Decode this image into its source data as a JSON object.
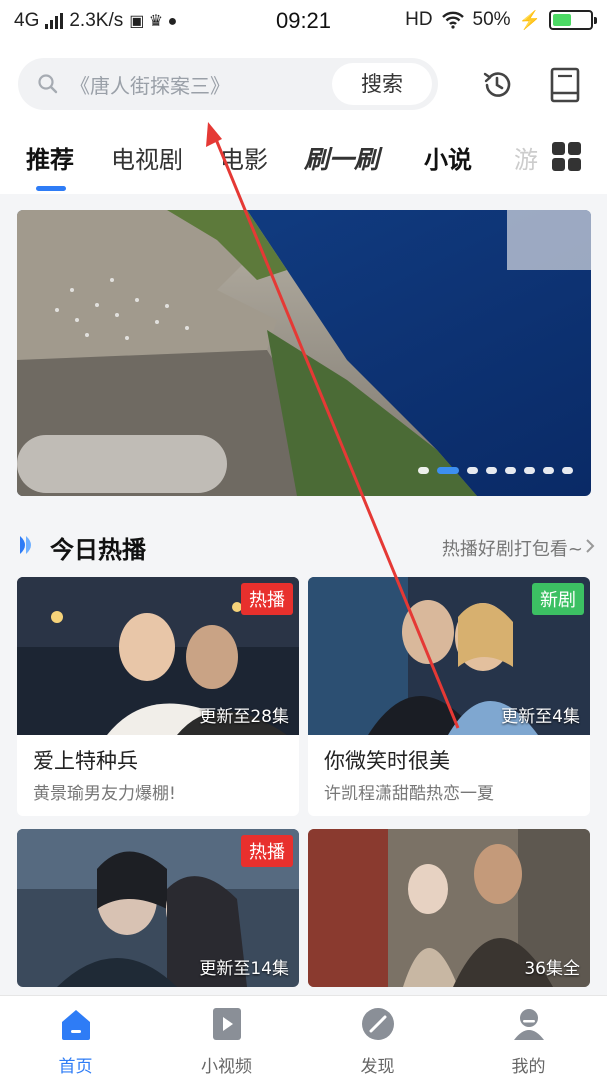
{
  "status_bar": {
    "network": "4G",
    "speed": "2.3K/s",
    "time": "09:21",
    "hd": "HD",
    "battery": "50%",
    "battery_level": 0.5
  },
  "search": {
    "placeholder": "《唐人街探案三》",
    "button": "搜索"
  },
  "tabs": [
    "推荐",
    "电视剧",
    "电影",
    "刷一刷",
    "小说",
    "游"
  ],
  "banner": {
    "dot_count": 8,
    "active_dot": 1
  },
  "section": {
    "title": "今日热播",
    "more": "热播好剧打包看~"
  },
  "cards": [
    {
      "name": "爱上特种兵",
      "desc": "黄景瑜男友力爆棚!",
      "badge": "热播",
      "episodes": "更新至28集"
    },
    {
      "name": "你微笑时很美",
      "desc": "许凯程潇甜酷热恋一夏",
      "badge": "新剧",
      "episodes": "更新至4集"
    },
    {
      "badge": "热播",
      "episodes": "更新至14集"
    },
    {
      "episodes": "36集全"
    }
  ],
  "nav": [
    {
      "label": "首页",
      "icon": "home-icon"
    },
    {
      "label": "小视频",
      "icon": "video-icon"
    },
    {
      "label": "发现",
      "icon": "compass-icon"
    },
    {
      "label": "我的",
      "icon": "profile-icon"
    }
  ],
  "colors": {
    "accent": "#2e7cf6",
    "hot_badge": "#e8302d",
    "new_badge": "#3cc063",
    "annotation": "#e53935"
  }
}
